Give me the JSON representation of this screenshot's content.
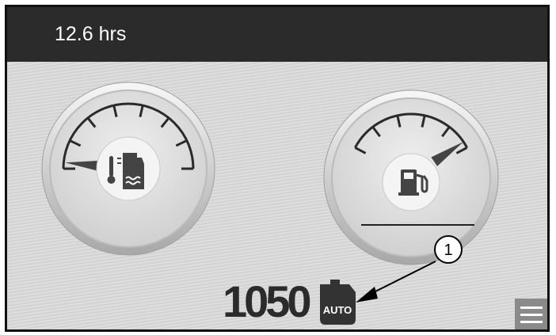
{
  "status_bar": {
    "engine_hours": "12.6 hrs"
  },
  "gauges": {
    "coolant_temp": {
      "icon": "coolant-temperature-icon",
      "needle_level": 0.02
    },
    "fuel": {
      "icon": "fuel-pump-icon",
      "needle_level": 0.95
    }
  },
  "engine": {
    "rpm": "1050",
    "mode_badge": "AUTO",
    "icon": "engine-icon"
  },
  "callout": {
    "number": "1"
  },
  "menu": {
    "icon": "hamburger-menu-icon"
  },
  "colors": {
    "bar": "#2b2b2b",
    "screen": "#d8d8d8",
    "needle": "#444444"
  }
}
